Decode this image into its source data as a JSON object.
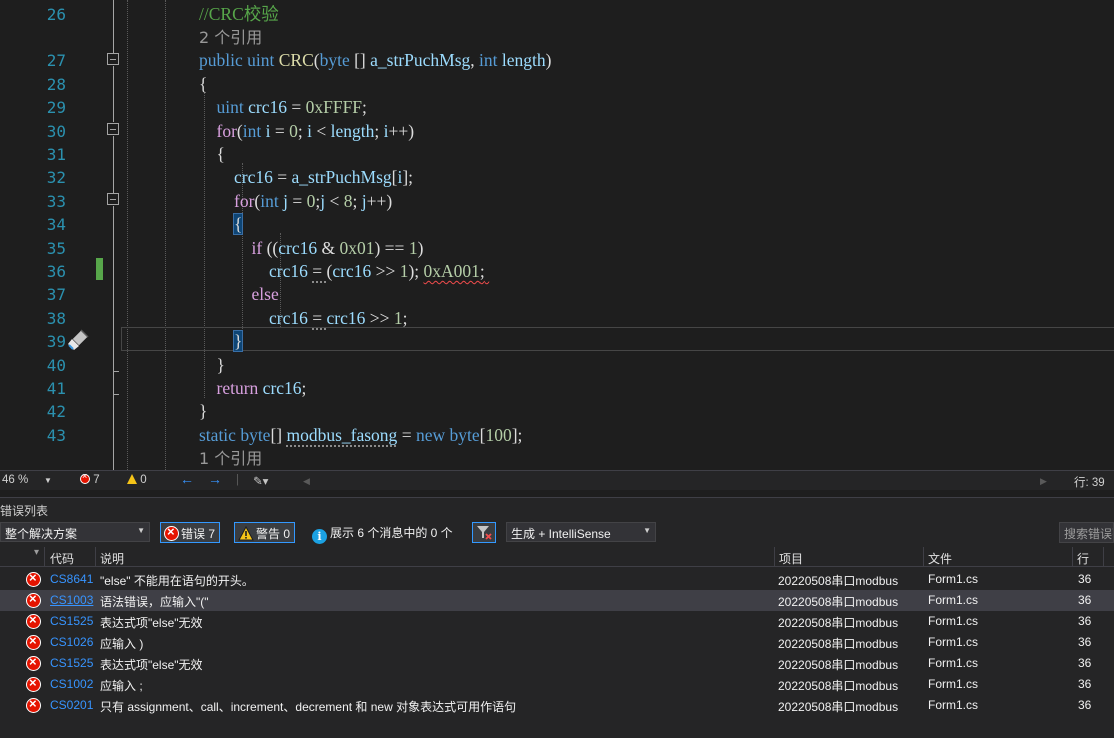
{
  "editor": {
    "lines": [
      {
        "n": "26",
        "tokens": [
          [
            "cm",
            "//CRC校验"
          ]
        ]
      },
      {
        "ref": "2 个引用"
      },
      {
        "n": "27",
        "tokens": [
          [
            "kw",
            "public"
          ],
          [
            "pl",
            " "
          ],
          [
            "kw",
            "uint"
          ],
          [
            "pl",
            " "
          ],
          [
            "fn",
            "CRC"
          ],
          [
            "pl",
            "("
          ],
          [
            "kw",
            "byte"
          ],
          [
            "pl",
            " [] "
          ],
          [
            "var",
            "a_strPuchMsg"
          ],
          [
            "pl",
            ", "
          ],
          [
            "kw",
            "int"
          ],
          [
            "pl",
            " "
          ],
          [
            "var",
            "length"
          ],
          [
            "pl",
            ")"
          ]
        ]
      },
      {
        "n": "28",
        "tokens": [
          [
            "pl",
            "{"
          ]
        ]
      },
      {
        "n": "29",
        "tokens": [
          [
            "pl",
            "    "
          ],
          [
            "kw",
            "uint"
          ],
          [
            "pl",
            " "
          ],
          [
            "var",
            "crc16"
          ],
          [
            "pl",
            " = "
          ],
          [
            "num",
            "0xFFFF"
          ],
          [
            "pl",
            ";"
          ]
        ]
      },
      {
        "n": "30",
        "tokens": [
          [
            "pl",
            "    "
          ],
          [
            "ctl",
            "for"
          ],
          [
            "pl",
            "("
          ],
          [
            "kw",
            "int"
          ],
          [
            "pl",
            " "
          ],
          [
            "var",
            "i"
          ],
          [
            "pl",
            " = "
          ],
          [
            "num",
            "0"
          ],
          [
            "pl",
            "; "
          ],
          [
            "var",
            "i"
          ],
          [
            "pl",
            " < "
          ],
          [
            "var",
            "length"
          ],
          [
            "pl",
            "; "
          ],
          [
            "var",
            "i"
          ],
          [
            "pl",
            "++)"
          ]
        ]
      },
      {
        "n": "31",
        "tokens": [
          [
            "pl",
            "    {"
          ]
        ]
      },
      {
        "n": "32",
        "tokens": [
          [
            "pl",
            "        "
          ],
          [
            "var",
            "crc16"
          ],
          [
            "pl",
            " = "
          ],
          [
            "var",
            "a_strPuchMsg"
          ],
          [
            "pl",
            "["
          ],
          [
            "var",
            "i"
          ],
          [
            "pl",
            "];"
          ]
        ]
      },
      {
        "n": "33",
        "tokens": [
          [
            "pl",
            "        "
          ],
          [
            "ctl",
            "for"
          ],
          [
            "pl",
            "("
          ],
          [
            "kw",
            "int"
          ],
          [
            "pl",
            " "
          ],
          [
            "var",
            "j"
          ],
          [
            "pl",
            " = "
          ],
          [
            "num",
            "0"
          ],
          [
            "pl",
            ";"
          ],
          [
            "var",
            "j"
          ],
          [
            "pl",
            " < "
          ],
          [
            "num",
            "8"
          ],
          [
            "pl",
            "; "
          ],
          [
            "var",
            "j"
          ],
          [
            "pl",
            "++)"
          ]
        ]
      },
      {
        "n": "34",
        "tokens": [
          [
            "pl",
            "        "
          ],
          [
            "hl",
            "{"
          ]
        ]
      },
      {
        "n": "35",
        "tokens": [
          [
            "pl",
            "            "
          ],
          [
            "ctl",
            "if"
          ],
          [
            "pl",
            " (("
          ],
          [
            "var",
            "crc16"
          ],
          [
            "pl",
            " & "
          ],
          [
            "num",
            "0x01"
          ],
          [
            "pl",
            ") == "
          ],
          [
            "num",
            "1"
          ],
          [
            "pl",
            ")"
          ]
        ]
      },
      {
        "n": "36",
        "tokens": [
          [
            "pl",
            "                "
          ],
          [
            "var",
            "crc16"
          ],
          [
            "pl",
            " "
          ],
          [
            "dots",
            "= "
          ],
          [
            "pl",
            "("
          ],
          [
            "var",
            "crc16"
          ],
          [
            "pl",
            " >> "
          ],
          [
            "num",
            "1"
          ],
          [
            "pl",
            "); "
          ],
          [
            "sq",
            "0xA001"
          ],
          [
            "sqp",
            ";"
          ],
          [
            "sqp",
            " "
          ]
        ]
      },
      {
        "n": "37",
        "tokens": [
          [
            "pl",
            "            "
          ],
          [
            "ctl",
            "else"
          ]
        ]
      },
      {
        "n": "38",
        "tokens": [
          [
            "pl",
            "                "
          ],
          [
            "var",
            "crc16"
          ],
          [
            "pl",
            " "
          ],
          [
            "dots",
            "= "
          ],
          [
            "var",
            "crc16"
          ],
          [
            "pl",
            " >> "
          ],
          [
            "num",
            "1"
          ],
          [
            "pl",
            ";"
          ]
        ]
      },
      {
        "n": "39",
        "tokens": [
          [
            "pl",
            "        "
          ],
          [
            "hl",
            "}"
          ]
        ]
      },
      {
        "n": "40",
        "tokens": [
          [
            "pl",
            "    }"
          ]
        ]
      },
      {
        "n": "41",
        "tokens": [
          [
            "pl",
            "    "
          ],
          [
            "ctl",
            "return"
          ],
          [
            "pl",
            " "
          ],
          [
            "var",
            "crc16"
          ],
          [
            "pl",
            ";"
          ]
        ]
      },
      {
        "n": "42",
        "tokens": [
          [
            "pl",
            "}"
          ]
        ]
      },
      {
        "n": "43",
        "tokens": [
          [
            "kw",
            "static"
          ],
          [
            "pl",
            " "
          ],
          [
            "kw",
            "byte"
          ],
          [
            "pl",
            "[] "
          ],
          [
            "dotsv",
            "modbus_fasong"
          ],
          [
            "pl",
            " = "
          ],
          [
            "kw",
            "new"
          ],
          [
            "pl",
            " "
          ],
          [
            "kw",
            "byte"
          ],
          [
            "pl",
            "["
          ],
          [
            "num",
            "100"
          ],
          [
            "pl",
            "];"
          ]
        ]
      },
      {
        "ref": "1 个引用"
      }
    ]
  },
  "status": {
    "zoom": "46 %",
    "errors": "7",
    "warnings": "0",
    "line": "行: 39"
  },
  "error_list": {
    "title": "错误列表",
    "scope": "整个解决方案",
    "errors_btn": "错误 7",
    "warnings_btn": "警告 0",
    "messages_btn": "展示 6 个消息中的 0 个",
    "build_filter": "生成 + IntelliSense",
    "search_placeholder": "搜索错误列表",
    "columns": {
      "code": "代码",
      "desc": "说明",
      "project": "项目",
      "file": "文件",
      "line": "行"
    },
    "rows": [
      {
        "code": "CS8641",
        "desc": "\"else\" 不能用在语句的开头。",
        "project": "20220508串口modbus",
        "file": "Form1.cs",
        "line": "36"
      },
      {
        "code": "CS1003",
        "desc": "语法错误，应输入\"(\"",
        "project": "20220508串口modbus",
        "file": "Form1.cs",
        "line": "36"
      },
      {
        "code": "CS1525",
        "desc": "表达式项\"else\"无效",
        "project": "20220508串口modbus",
        "file": "Form1.cs",
        "line": "36"
      },
      {
        "code": "CS1026",
        "desc": "应输入 )",
        "project": "20220508串口modbus",
        "file": "Form1.cs",
        "line": "36"
      },
      {
        "code": "CS1525",
        "desc": "表达式项\"else\"无效",
        "project": "20220508串口modbus",
        "file": "Form1.cs",
        "line": "36"
      },
      {
        "code": "CS1002",
        "desc": "应输入 ;",
        "project": "20220508串口modbus",
        "file": "Form1.cs",
        "line": "36"
      },
      {
        "code": "CS0201",
        "desc": "只有 assignment、call、increment、decrement 和 new 对象表达式可用作语句",
        "project": "20220508串口modbus",
        "file": "Form1.cs",
        "line": "36"
      }
    ],
    "selected_row": 1
  }
}
